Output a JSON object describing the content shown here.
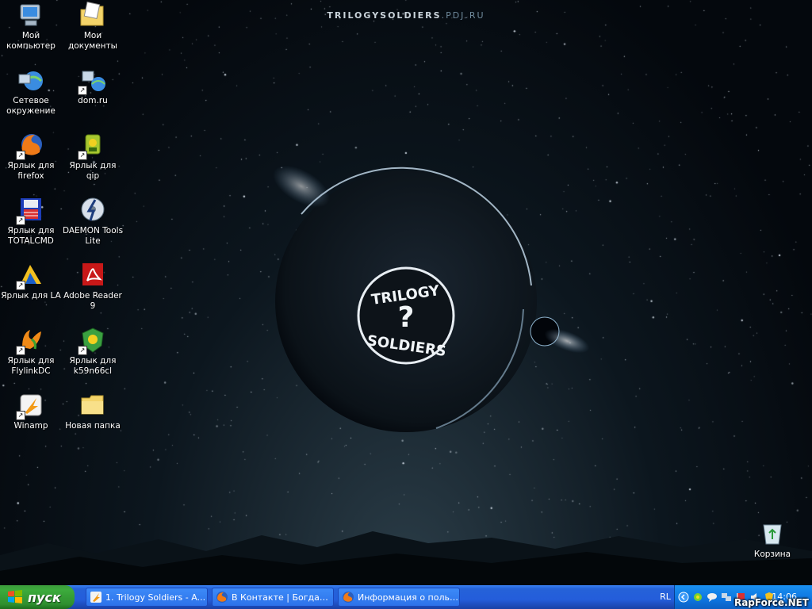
{
  "wallpaper": {
    "title_main": "TRILOGYSOLDIERS",
    "title_sub": ".PDJ.RU",
    "logo_top": "TRILOGY",
    "logo_bottom": "SOLDIERS",
    "logo_mark": "?"
  },
  "desktop_icons": [
    {
      "label": "Мой компьютер",
      "icon": "my-computer-icon"
    },
    {
      "label": "Мои документы",
      "icon": "my-documents-icon"
    },
    {
      "label": "Сетевое окружение",
      "icon": "network-places-icon"
    },
    {
      "label": "dom.ru",
      "icon": "network-shortcut-icon"
    },
    {
      "label": "Ярлык для firefox",
      "icon": "firefox-icon"
    },
    {
      "label": "Ярлык для qip",
      "icon": "qip-icon"
    },
    {
      "label": "Ярлык для TOTALCMD",
      "icon": "totalcmd-icon"
    },
    {
      "label": "DAEMON Tools Lite",
      "icon": "daemon-tools-icon"
    },
    {
      "label": "Ярлык для LA",
      "icon": "la-icon"
    },
    {
      "label": "Adobe Reader 9",
      "icon": "adobe-reader-icon"
    },
    {
      "label": "Ярлык для FlylinkDC",
      "icon": "flylinkdc-icon"
    },
    {
      "label": "Ярлык для k59n66cl",
      "icon": "k59n66cl-icon"
    },
    {
      "label": "Winamp",
      "icon": "winamp-icon"
    },
    {
      "label": "Новая папка",
      "icon": "folder-icon"
    },
    {
      "label": "Корзина",
      "icon": "recycle-bin-icon"
    }
  ],
  "taskbar": {
    "start_label": "пуск",
    "tasks": [
      {
        "label": "1. Trilogy Soldiers - A...",
        "icon": "winamp-icon"
      },
      {
        "label": "В Контакте | Богдан...",
        "icon": "firefox-icon"
      },
      {
        "label": "Информация о польз...",
        "icon": "firefox-icon"
      }
    ],
    "language": "RL",
    "clock": "14:06",
    "watermark": "RapForce.NET"
  },
  "colors": {
    "taskbar": "#245ddb",
    "start_button": "#3cab3c",
    "tray": "#0d75e0"
  }
}
